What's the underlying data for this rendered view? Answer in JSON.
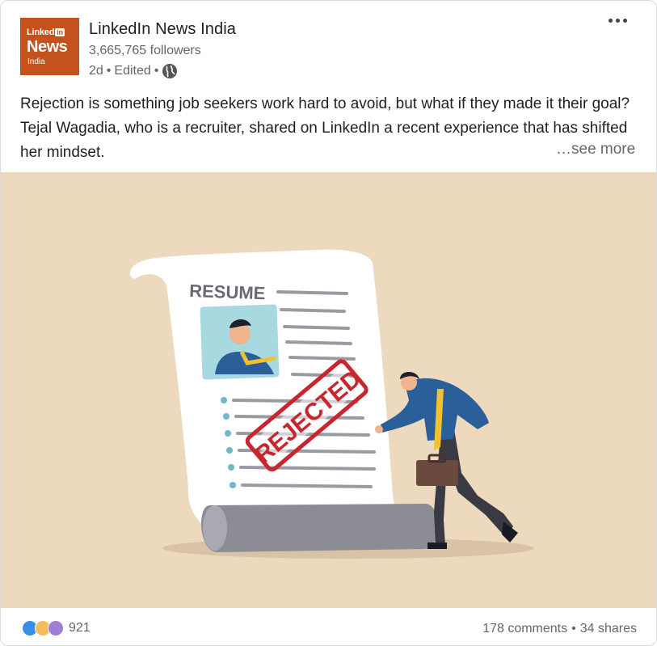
{
  "post": {
    "author": {
      "name": "LinkedIn News India",
      "followers": "3,665,765 followers",
      "time": "2d",
      "edited": "Edited",
      "logo_line1": "Linked",
      "logo_in": "in",
      "logo_line2": "News",
      "logo_line3": "India",
      "logo_color": "#c4521c"
    },
    "text": "Rejection is something job seekers work hard to avoid, but what if they made it their goal? Tejal Wagadia, who is a recruiter, shared on LinkedIn a recent experience that has shifted her mindset.",
    "see_more": "…see more",
    "image": {
      "resume_heading": "RESUME",
      "stamp_text": "REJECTED",
      "background": "#edd9be"
    },
    "reactions": {
      "count": "921",
      "icons": [
        "like-icon",
        "insightful-icon",
        "support-icon"
      ]
    },
    "comments": "178 comments",
    "shares": "34 shares",
    "separator": "•"
  }
}
